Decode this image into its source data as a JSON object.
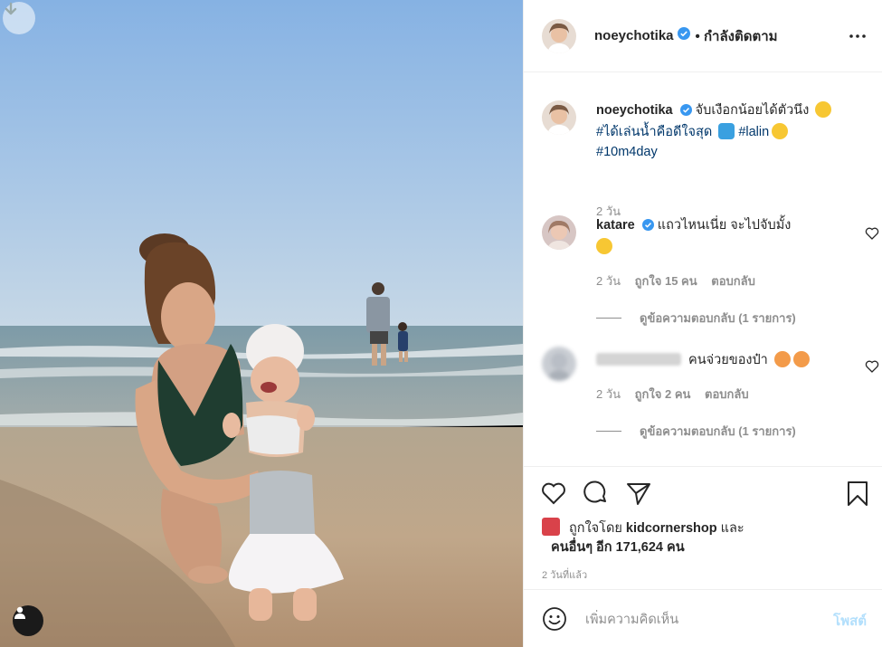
{
  "header": {
    "username": "noeychotika",
    "follow_status": "• กำลังติดตาม",
    "more_icon": "ellipsis-icon"
  },
  "caption": {
    "username": "noeychotika",
    "text": "จับเงือกน้อยได้ตัวนึง",
    "hashtag1": "#ได้เล่นน้ำคือดีใจสุด",
    "hashtag2": "#lalin",
    "hashtag3": "#10m4day",
    "time": "2 วัน"
  },
  "comments": [
    {
      "username": "katare",
      "text": "แถวไหนเนี่ย จะไปจับมั้ง",
      "time": "2 วัน",
      "likes": "ถูกใจ 15 คน",
      "reply": "ตอบกลับ",
      "view_replies": "ดูข้อความตอบกลับ (1 รายการ)"
    },
    {
      "text": "คนจ่วยของป๋า",
      "time": "2 วัน",
      "likes": "ถูกใจ 2 คน",
      "reply": "ตอบกลับ",
      "view_replies": "ดูข้อความตอบกลับ (1 รายการ)"
    }
  ],
  "actions": {
    "like_icon": "heart-icon",
    "comment_icon": "comment-icon",
    "share_icon": "paper-plane-icon",
    "save_icon": "bookmark-icon"
  },
  "likes": {
    "prefix": "ถูกใจโดย",
    "user": "kidcornershop",
    "and": "และ",
    "others": "คนอื่นๆ อีก 171,624 คน"
  },
  "posted_ago": "2 วันที่แล้ว",
  "add_comment": {
    "placeholder": "เพิ่มความคิดเห็น",
    "post_label": "โพสต์"
  },
  "colors": {
    "verified": "#3897f0",
    "link": "#00376b",
    "muted": "#8e8e8e",
    "post_disabled": "#b2dffc"
  }
}
